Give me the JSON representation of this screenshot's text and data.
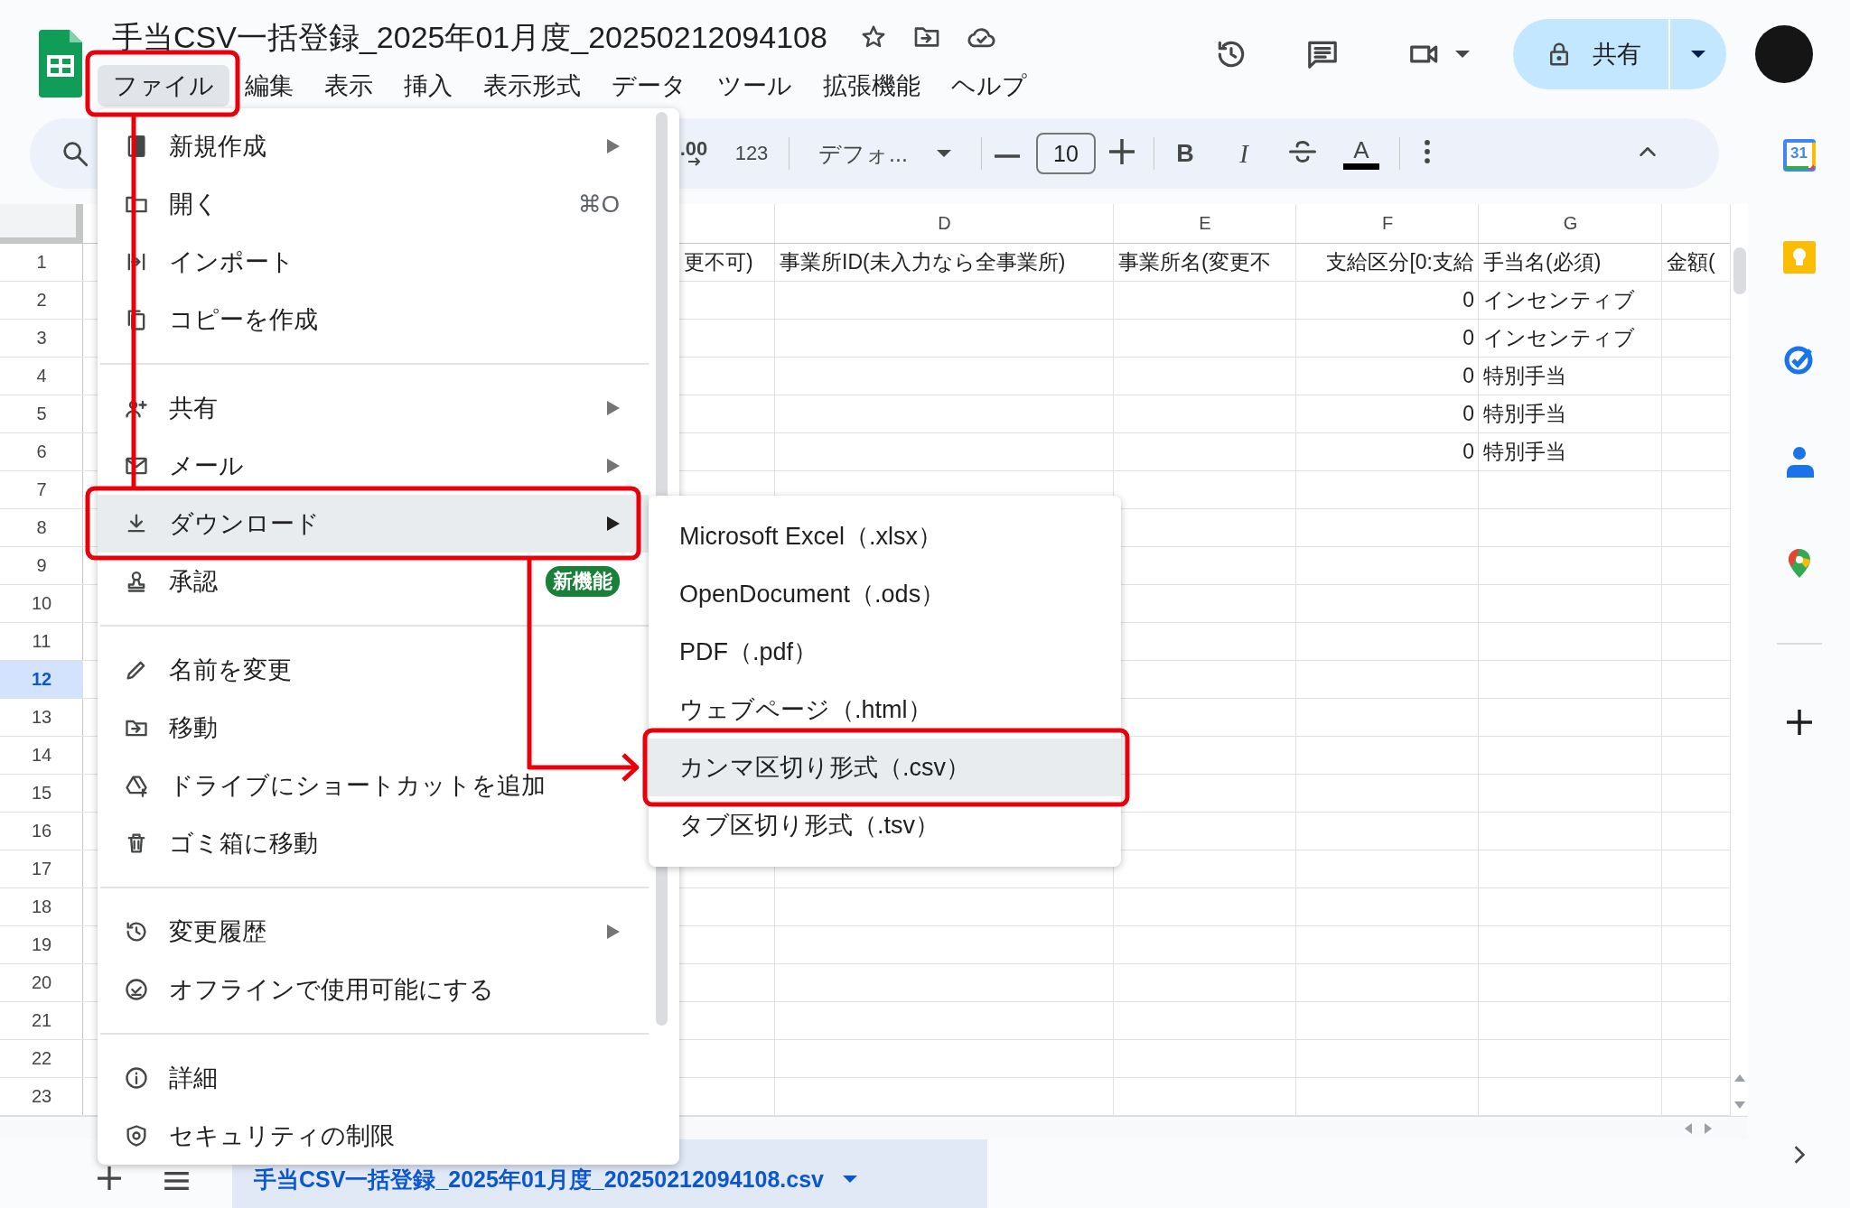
{
  "document": {
    "title": "手当CSV一括登録_2025年01月度_20250212094108"
  },
  "menubar": [
    {
      "label": "ファイル",
      "selected": true
    },
    {
      "label": "編集",
      "selected": false
    },
    {
      "label": "表示",
      "selected": false
    },
    {
      "label": "挿入",
      "selected": false
    },
    {
      "label": "表示形式",
      "selected": false
    },
    {
      "label": "データ",
      "selected": false
    },
    {
      "label": "ツール",
      "selected": false
    },
    {
      "label": "拡張機能",
      "selected": false
    },
    {
      "label": "ヘルプ",
      "selected": false
    }
  ],
  "share_button": {
    "label": "共有"
  },
  "toolbar": {
    "decimal": ".00",
    "number_format": "123",
    "font": "デフォ...",
    "font_size": "10",
    "bold": "B",
    "italic": "I",
    "text_color": "A"
  },
  "sheet": {
    "column_headers": [
      "D",
      "E",
      "F",
      "G"
    ],
    "rows": [
      {
        "number": "1",
        "selected": false,
        "cells": {
          "C": "更不可)",
          "D": "事業所ID(未入力なら全事業所)",
          "E": "事業所名(変更不",
          "F": "支給区分[0:支給",
          "G": "手当名(必須)",
          "H": "金額("
        }
      },
      {
        "number": "2",
        "selected": false,
        "cells": {
          "F": "0",
          "G": "インセンティブ"
        }
      },
      {
        "number": "3",
        "selected": false,
        "cells": {
          "F": "0",
          "G": "インセンティブ"
        }
      },
      {
        "number": "4",
        "selected": false,
        "cells": {
          "F": "0",
          "G": "特別手当"
        }
      },
      {
        "number": "5",
        "selected": false,
        "cells": {
          "F": "0",
          "G": "特別手当"
        }
      },
      {
        "number": "6",
        "selected": false,
        "cells": {
          "F": "0",
          "G": "特別手当"
        }
      },
      {
        "number": "7",
        "selected": false
      },
      {
        "number": "8",
        "selected": false
      },
      {
        "number": "9",
        "selected": false
      },
      {
        "number": "10",
        "selected": false
      },
      {
        "number": "11",
        "selected": false
      },
      {
        "number": "12",
        "selected": true
      },
      {
        "number": "13",
        "selected": false
      },
      {
        "number": "14",
        "selected": false
      },
      {
        "number": "15",
        "selected": false
      },
      {
        "number": "16",
        "selected": false
      },
      {
        "number": "17",
        "selected": false
      },
      {
        "number": "18",
        "selected": false
      },
      {
        "number": "19",
        "selected": false
      },
      {
        "number": "20",
        "selected": false
      },
      {
        "number": "21",
        "selected": false
      },
      {
        "number": "22",
        "selected": false
      },
      {
        "number": "23",
        "selected": false
      }
    ]
  },
  "file_menu": {
    "sections": [
      [
        {
          "label": "新規作成",
          "submenu": true,
          "selected": false
        },
        {
          "label": "開く",
          "shortcut": "⌘O",
          "submenu": false,
          "selected": false
        },
        {
          "label": "インポート",
          "submenu": false,
          "selected": false
        },
        {
          "label": "コピーを作成",
          "submenu": false,
          "selected": false
        }
      ],
      [
        {
          "label": "共有",
          "submenu": true,
          "selected": false
        },
        {
          "label": "メール",
          "submenu": true,
          "selected": false
        },
        {
          "label": "ダウンロード",
          "submenu": true,
          "selected": true
        },
        {
          "label": "承認",
          "badge": "新機能",
          "submenu": false,
          "selected": false
        }
      ],
      [
        {
          "label": "名前を変更",
          "submenu": false,
          "selected": false
        },
        {
          "label": "移動",
          "submenu": false,
          "selected": false
        },
        {
          "label": "ドライブにショートカットを追加",
          "submenu": false,
          "selected": false
        },
        {
          "label": "ゴミ箱に移動",
          "submenu": false,
          "selected": false
        }
      ],
      [
        {
          "label": "変更履歴",
          "submenu": true,
          "selected": false
        },
        {
          "label": "オフラインで使用可能にする",
          "submenu": false,
          "selected": false
        }
      ],
      [
        {
          "label": "詳細",
          "submenu": false,
          "selected": false
        },
        {
          "label": "セキュリティの制限",
          "submenu": false,
          "selected": false
        }
      ]
    ]
  },
  "download_submenu": [
    {
      "label": "Microsoft Excel（.xlsx）",
      "selected": false
    },
    {
      "label": "OpenDocument（.ods）",
      "selected": false
    },
    {
      "label": "PDF（.pdf）",
      "selected": false
    },
    {
      "label": "ウェブページ（.html）",
      "selected": false
    },
    {
      "label": "カンマ区切り形式（.csv）",
      "selected": true
    },
    {
      "label": "タブ区切り形式（.tsv）",
      "selected": false
    }
  ],
  "sheet_tab": {
    "label": "手当CSV一括登録_2025年01月度_20250212094108.csv",
    "selected": true
  },
  "side_panel": {
    "calendar_date": "31"
  }
}
